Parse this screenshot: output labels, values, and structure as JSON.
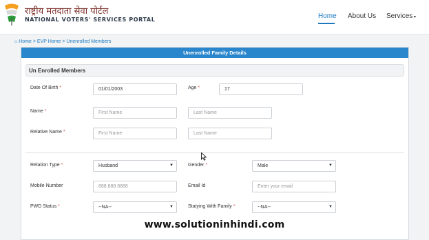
{
  "brand": {
    "hindi": "राष्ट्रीय मतदाता सेवा पोर्टल",
    "english": "NATIONAL VOTERS' SERVICES PORTAL",
    "logo_colors": [
      "#f4a020",
      "#ffffff",
      "#2c9a3a"
    ]
  },
  "nav": {
    "home": "Home",
    "about": "About Us",
    "services": "Services",
    "services_icon": "caret-down-icon"
  },
  "breadcrumb": {
    "home": "Home",
    "evp_home": "EVP Home",
    "current": "Unenrolled Members",
    "sep": ">"
  },
  "card": {
    "title": "Unenrolled Family Details"
  },
  "section": {
    "title": "Un Enrolled Members"
  },
  "form": {
    "dob_label": "Date Of Birth",
    "dob_value": "01/01/2003",
    "age_label": "Age",
    "age_value": "17",
    "name_label": "Name",
    "first_name_placeholder": "First Name",
    "last_name_placeholder": "Last Name",
    "relative_label": "Relative Name",
    "relative_first_placeholder": "First Name",
    "relative_last_placeholder": "Last Name",
    "relation_type_label": "Relation Type",
    "relation_type_value": "Husband",
    "gender_label": "Gender",
    "gender_value": "Male",
    "mobile_label": "Mobile Number",
    "mobile_placeholder": "888 888 8888",
    "email_label": "Email Id",
    "email_placeholder": "Enter your email",
    "pwd_label": "PWD Status",
    "pwd_value": "--NA--",
    "staying_label": "Statying With Family",
    "staying_value": "--NA--",
    "required_mark": "*"
  },
  "watermark": "www.solutioninhindi.com"
}
